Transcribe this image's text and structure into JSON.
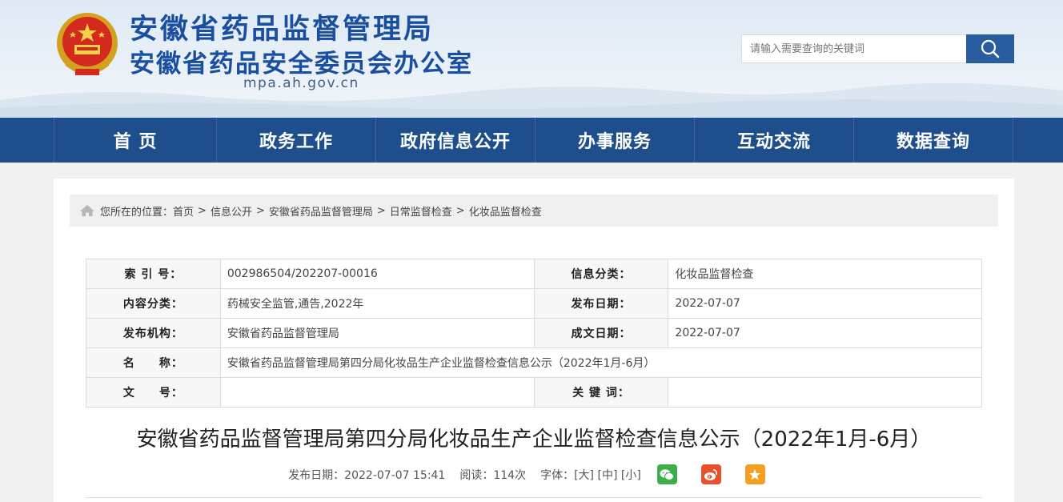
{
  "header": {
    "title_1": "安徽省药品监督管理局",
    "title_2": "安徽省药品安全委员会办公室",
    "domain": "mpa.ah.gov.cn",
    "search_placeholder": "请输入需要查询的关键词"
  },
  "nav": [
    "首 页",
    "政务工作",
    "政府信息公开",
    "办事服务",
    "互动交流",
    "数据查询"
  ],
  "breadcrumb": {
    "prefix": "您所在的位置：",
    "items": [
      "首页",
      "信息公开",
      "安徽省药品监督管理局",
      "日常监督检查",
      "化妆品监督检查"
    ],
    "separator": ">"
  },
  "meta_table": {
    "index_label": "索 引 号：",
    "index_value": "002986504/202207-00016",
    "category_label": "信息分类：",
    "category_value": "化妆品监督检查",
    "content_category_label": "内容分类：",
    "content_category_value": "药械安全监管,通告,2022年",
    "publish_date_label": "发布日期：",
    "publish_date_value": "2022-07-07",
    "publisher_label": "发布机构：",
    "publisher_value": "安徽省药品监督管理局",
    "created_date_label": "成文日期：",
    "created_date_value": "2022-07-07",
    "name_label": "名　　称：",
    "name_value": "安徽省药品监督管理局第四分局化妆品生产企业监督检查信息公示（2022年1月-6月）",
    "doc_no_label": "文　　号：",
    "doc_no_value": "",
    "keywords_label": "关 键 词：",
    "keywords_value": ""
  },
  "article": {
    "title": "安徽省药品监督管理局第四分局化妆品生产企业监督检查信息公示（2022年1月-6月）",
    "publish_time": "发布日期：2022-07-07 15:41",
    "reads": "阅读：114次",
    "font_label": "字体：",
    "font_large": "[大]",
    "font_medium": "[中]",
    "font_small": "[小]"
  },
  "colors": {
    "brand_blue": "#1e4e8c",
    "title_blue": "#1a4ea0",
    "wechat": "#3dae48",
    "weibo": "#e8502f",
    "favorite": "#f3a022"
  }
}
